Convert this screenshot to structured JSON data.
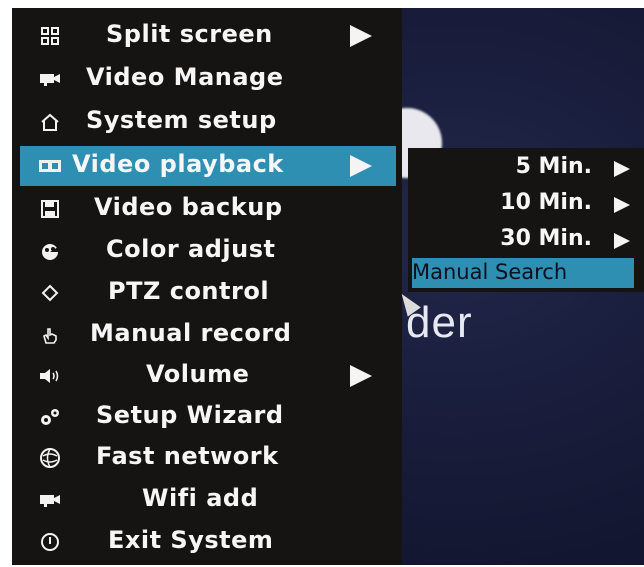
{
  "main_menu": {
    "items": [
      {
        "label": "Split screen",
        "icon": "grid-icon",
        "has_submenu": true
      },
      {
        "label": "Video Manage",
        "icon": "camera-icon",
        "has_submenu": false
      },
      {
        "label": "System setup",
        "icon": "home-icon",
        "has_submenu": false
      },
      {
        "label": "Video playback",
        "icon": "film-icon",
        "has_submenu": true,
        "selected": true
      },
      {
        "label": "Video backup",
        "icon": "floppy-icon",
        "has_submenu": false
      },
      {
        "label": "Color adjust",
        "icon": "palette-icon",
        "has_submenu": false
      },
      {
        "label": "PTZ control",
        "icon": "ptz-icon",
        "has_submenu": false
      },
      {
        "label": "Manual record",
        "icon": "hand-icon",
        "has_submenu": false
      },
      {
        "label": "Volume",
        "icon": "speaker-icon",
        "has_submenu": true
      },
      {
        "label": "Setup Wizard",
        "icon": "gears-icon",
        "has_submenu": false
      },
      {
        "label": "Fast network",
        "icon": "globe-icon",
        "has_submenu": false
      },
      {
        "label": "Wifi add",
        "icon": "camera-icon",
        "has_submenu": false
      },
      {
        "label": "Exit System",
        "icon": "power-icon",
        "has_submenu": false
      }
    ]
  },
  "playback_submenu": {
    "items": [
      {
        "label": "5 Min."
      },
      {
        "label": "10 Min."
      },
      {
        "label": "30 Min."
      },
      {
        "label": "Manual Search",
        "selected": true
      }
    ]
  },
  "background": {
    "text": "der"
  },
  "colors": {
    "menu_bg": "#161413",
    "highlight": "#2e8fb2",
    "screen_bg": "#161a36",
    "text": "#f6f6f6"
  }
}
